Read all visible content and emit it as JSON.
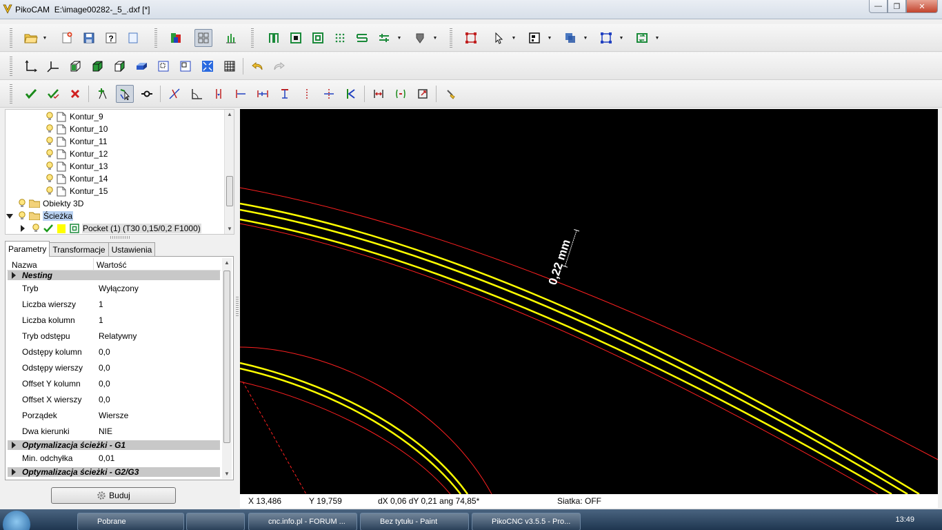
{
  "window": {
    "app_name": "PikoCAM",
    "file_path": "E:\\image00282-_5_.dxf [*]",
    "minimize": "—",
    "maximize": "❐",
    "close": "✕"
  },
  "tree": {
    "contours": [
      "Kontur_9",
      "Kontur_10",
      "Kontur_11",
      "Kontur_12",
      "Kontur_13",
      "Kontur_14",
      "Kontur_15"
    ],
    "objects3d": "Obiekty 3D",
    "path": "Ścieżka",
    "pocket": "Pocket (1) (T30 0,15/0,2 F1000)"
  },
  "tabs": [
    "Parametry",
    "Transformacje",
    "Ustawienia"
  ],
  "props": {
    "col_name": "Nazwa",
    "col_value": "Wartość",
    "group_nesting": "Nesting",
    "rows": [
      {
        "k": "Tryb",
        "v": "Wyłączony"
      },
      {
        "k": "Liczba wierszy",
        "v": "1"
      },
      {
        "k": "Liczba kolumn",
        "v": "1"
      },
      {
        "k": "Tryb odstępu",
        "v": "Relatywny"
      },
      {
        "k": "Odstępy kolumn",
        "v": "0,0"
      },
      {
        "k": "Odstępy wierszy",
        "v": "0,0"
      },
      {
        "k": "Offset Y kolumn",
        "v": "0,0"
      },
      {
        "k": "Offset X wierszy",
        "v": "0,0"
      },
      {
        "k": "Porządek",
        "v": "Wiersze"
      },
      {
        "k": "Dwa kierunki",
        "v": "NIE"
      }
    ],
    "group_g1": "Optymalizacja ścieżki - G1",
    "min_dev_label": "Min. odchyłka",
    "min_dev_value": "0,01",
    "group_g2g3": "Optymalizacja ścieżki - G2/G3"
  },
  "build_button": "Buduj",
  "canvas": {
    "dimension_label": "0,22 mm"
  },
  "status": {
    "x": "X 13,486",
    "y": "Y 19,759",
    "dxdy": "dX 0,06  dY 0,21  ang 74,85*",
    "grid": "Siatka: OFF"
  },
  "taskbar": {
    "items": [
      "Pobrane",
      "cnc.info.pl - FORUM ...",
      "Bez tytułu - Paint",
      "PikoCNC v3.5.5 - Pro..."
    ],
    "clock": "13:49"
  },
  "colors": {
    "accent": "#f0e040",
    "contour": "#ff2020",
    "toolpath": "#ffff00",
    "canvas_bg": "#000000"
  }
}
